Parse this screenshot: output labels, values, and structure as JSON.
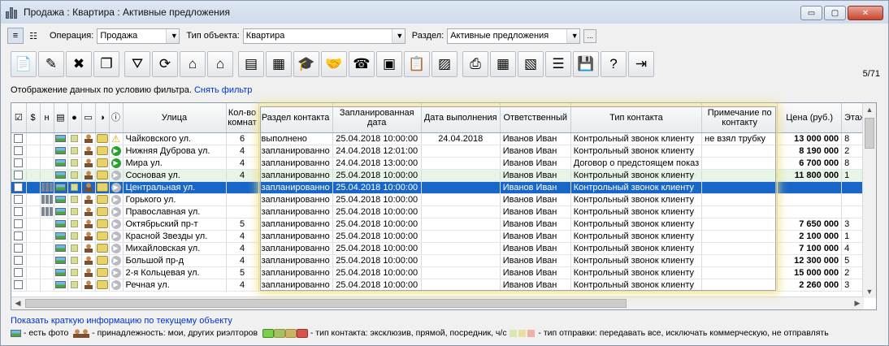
{
  "window": {
    "title": "Продажа : Квартира : Активные предложения",
    "min_icon": "▭",
    "max_icon": "▢",
    "close_icon": "✕"
  },
  "filters": {
    "operation_label": "Операция:",
    "operation_value": "Продажа",
    "object_label": "Тип объекта:",
    "object_value": "Квартира",
    "section_label": "Раздел:",
    "section_value": "Активные предложения",
    "more_label": "..."
  },
  "toolbar_icons": [
    "add-doc-icon",
    "edit-doc-icon",
    "delete-icon",
    "copy-icon",
    "filter-icon",
    "refresh-icon",
    "house-search-icon",
    "house-icon",
    "folders-icon",
    "report-icon",
    "graduation-icon",
    "handshake-icon",
    "phone-add-icon",
    "briefcase-icon",
    "clipboard-icon",
    "picture-icon",
    "printer-icon",
    "grid-icon",
    "map-icon",
    "document-list-icon",
    "export-icon",
    "help-icon",
    "exit-icon"
  ],
  "toolbar_glyphs": [
    "📄",
    "✎",
    "✖",
    "❐",
    "⛛",
    "⟳",
    "⌂",
    "⌂",
    "▤",
    "▦",
    "🎓",
    "🤝",
    "☎",
    "▣",
    "📋",
    "▨",
    "⎙",
    "▦",
    "▧",
    "☰",
    "💾",
    "?",
    "⇥"
  ],
  "counter": "5/71",
  "filter_info": {
    "text": "Отображение данных по условию фильтра.",
    "link": "Снять фильтр"
  },
  "columns": {
    "checkbox": "☑",
    "dollar": "$",
    "n": "н",
    "street": "Улица",
    "rooms": "Кол-во комнат",
    "section": "Раздел контакта",
    "planned": "Запланированная дата",
    "done": "Дата выполнения",
    "responsible": "Ответственный",
    "type": "Тип контакта",
    "note": "Примечание по контакту",
    "price": "Цена (руб.)",
    "floor": "Этаж"
  },
  "rows": [
    {
      "street": "Чайковского ул.",
      "rooms": "6",
      "section": "выполнено",
      "planned": "25.04.2018 10:00:00",
      "done": "24.04.2018",
      "responsible": "Иванов Иван",
      "type": "Контрольный звонок клиенту",
      "note": "не взял трубку",
      "price": "13 000 000",
      "floor": "8",
      "status": "warn",
      "bld": false
    },
    {
      "street": "Нижняя Дуброва ул.",
      "rooms": "4",
      "section": "запланированно",
      "planned": "24.04.2018 12:01:00",
      "done": "",
      "responsible": "Иванов Иван",
      "type": "Контрольный звонок клиенту",
      "note": "",
      "price": "8 190 000",
      "floor": "2",
      "status": "g",
      "bld": false
    },
    {
      "street": "Мира ул.",
      "rooms": "4",
      "section": "запланированно",
      "planned": "24.04.2018 13:00:00",
      "done": "",
      "responsible": "Иванов Иван",
      "type": "Договор о предстоящем показ",
      "note": "",
      "price": "6 700 000",
      "floor": "8",
      "status": "g",
      "bld": false
    },
    {
      "street": "Сосновая ул.",
      "rooms": "4",
      "section": "запланированно",
      "planned": "25.04.2018 10:00:00",
      "done": "",
      "responsible": "Иванов Иван",
      "type": "Контрольный звонок клиенту",
      "note": "",
      "price": "11 800 000",
      "floor": "1",
      "status": "",
      "bld": false,
      "green": true
    },
    {
      "street": "Центральная ул.",
      "rooms": "",
      "section": "запланированно",
      "planned": "25.04.2018 10:00:00",
      "done": "",
      "responsible": "Иванов Иван",
      "type": "Контрольный звонок клиенту",
      "note": "",
      "price": "",
      "floor": "",
      "status": "",
      "bld": true,
      "sel": true
    },
    {
      "street": "Горького ул.",
      "rooms": "",
      "section": "запланированно",
      "planned": "25.04.2018 10:00:00",
      "done": "",
      "responsible": "Иванов Иван",
      "type": "Контрольный звонок клиенту",
      "note": "",
      "price": "",
      "floor": "",
      "status": "",
      "bld": true
    },
    {
      "street": "Православная ул.",
      "rooms": "",
      "section": "запланированно",
      "planned": "25.04.2018 10:00:00",
      "done": "",
      "responsible": "Иванов Иван",
      "type": "Контрольный звонок клиенту",
      "note": "",
      "price": "",
      "floor": "",
      "status": "",
      "bld": true
    },
    {
      "street": "Октябрьский пр-т",
      "rooms": "5",
      "section": "запланированно",
      "planned": "25.04.2018 10:00:00",
      "done": "",
      "responsible": "Иванов Иван",
      "type": "Контрольный звонок клиенту",
      "note": "",
      "price": "7 650 000",
      "floor": "3",
      "status": "",
      "bld": false
    },
    {
      "street": "Красной Звезды ул.",
      "rooms": "4",
      "section": "запланированно",
      "planned": "25.04.2018 10:00:00",
      "done": "",
      "responsible": "Иванов Иван",
      "type": "Контрольный звонок клиенту",
      "note": "",
      "price": "2 100 000",
      "floor": "1",
      "status": "",
      "bld": false
    },
    {
      "street": "Михайловская ул.",
      "rooms": "4",
      "section": "запланированно",
      "planned": "25.04.2018 10:00:00",
      "done": "",
      "responsible": "Иванов Иван",
      "type": "Контрольный звонок клиенту",
      "note": "",
      "price": "7 100 000",
      "floor": "4",
      "status": "",
      "bld": false
    },
    {
      "street": "Большой пр-д",
      "rooms": "4",
      "section": "запланированно",
      "planned": "25.04.2018 10:00:00",
      "done": "",
      "responsible": "Иванов Иван",
      "type": "Контрольный звонок клиенту",
      "note": "",
      "price": "12 300 000",
      "floor": "5",
      "status": "",
      "bld": false
    },
    {
      "street": "2-я Кольцевая ул.",
      "rooms": "5",
      "section": "запланированно",
      "planned": "25.04.2018 10:00:00",
      "done": "",
      "responsible": "Иванов Иван",
      "type": "Контрольный звонок клиенту",
      "note": "",
      "price": "15 000 000",
      "floor": "2",
      "status": "",
      "bld": false
    },
    {
      "street": "Речная ул.",
      "rooms": "4",
      "section": "запланированно",
      "planned": "25.04.2018 10:00:00",
      "done": "",
      "responsible": "Иванов Иван",
      "type": "Контрольный звонок клиенту",
      "note": "",
      "price": "2 260 000",
      "floor": "3",
      "status": "",
      "bld": false
    }
  ],
  "short_info": "Показать краткую информацию по текущему объекту",
  "legend": {
    "photo": "- есть фото",
    "ownership": "- принадлежность: мои, других риэлторов",
    "contact_type": "- тип контакта: эксклюзив, прямой, посредник, ч/с",
    "send_type": "- тип отправки: передавать все, исключать коммерческую, не отправлять"
  },
  "colors": {
    "selection": "#1766c8",
    "highlight": "#e6f5e6",
    "link": "#0033cc"
  }
}
